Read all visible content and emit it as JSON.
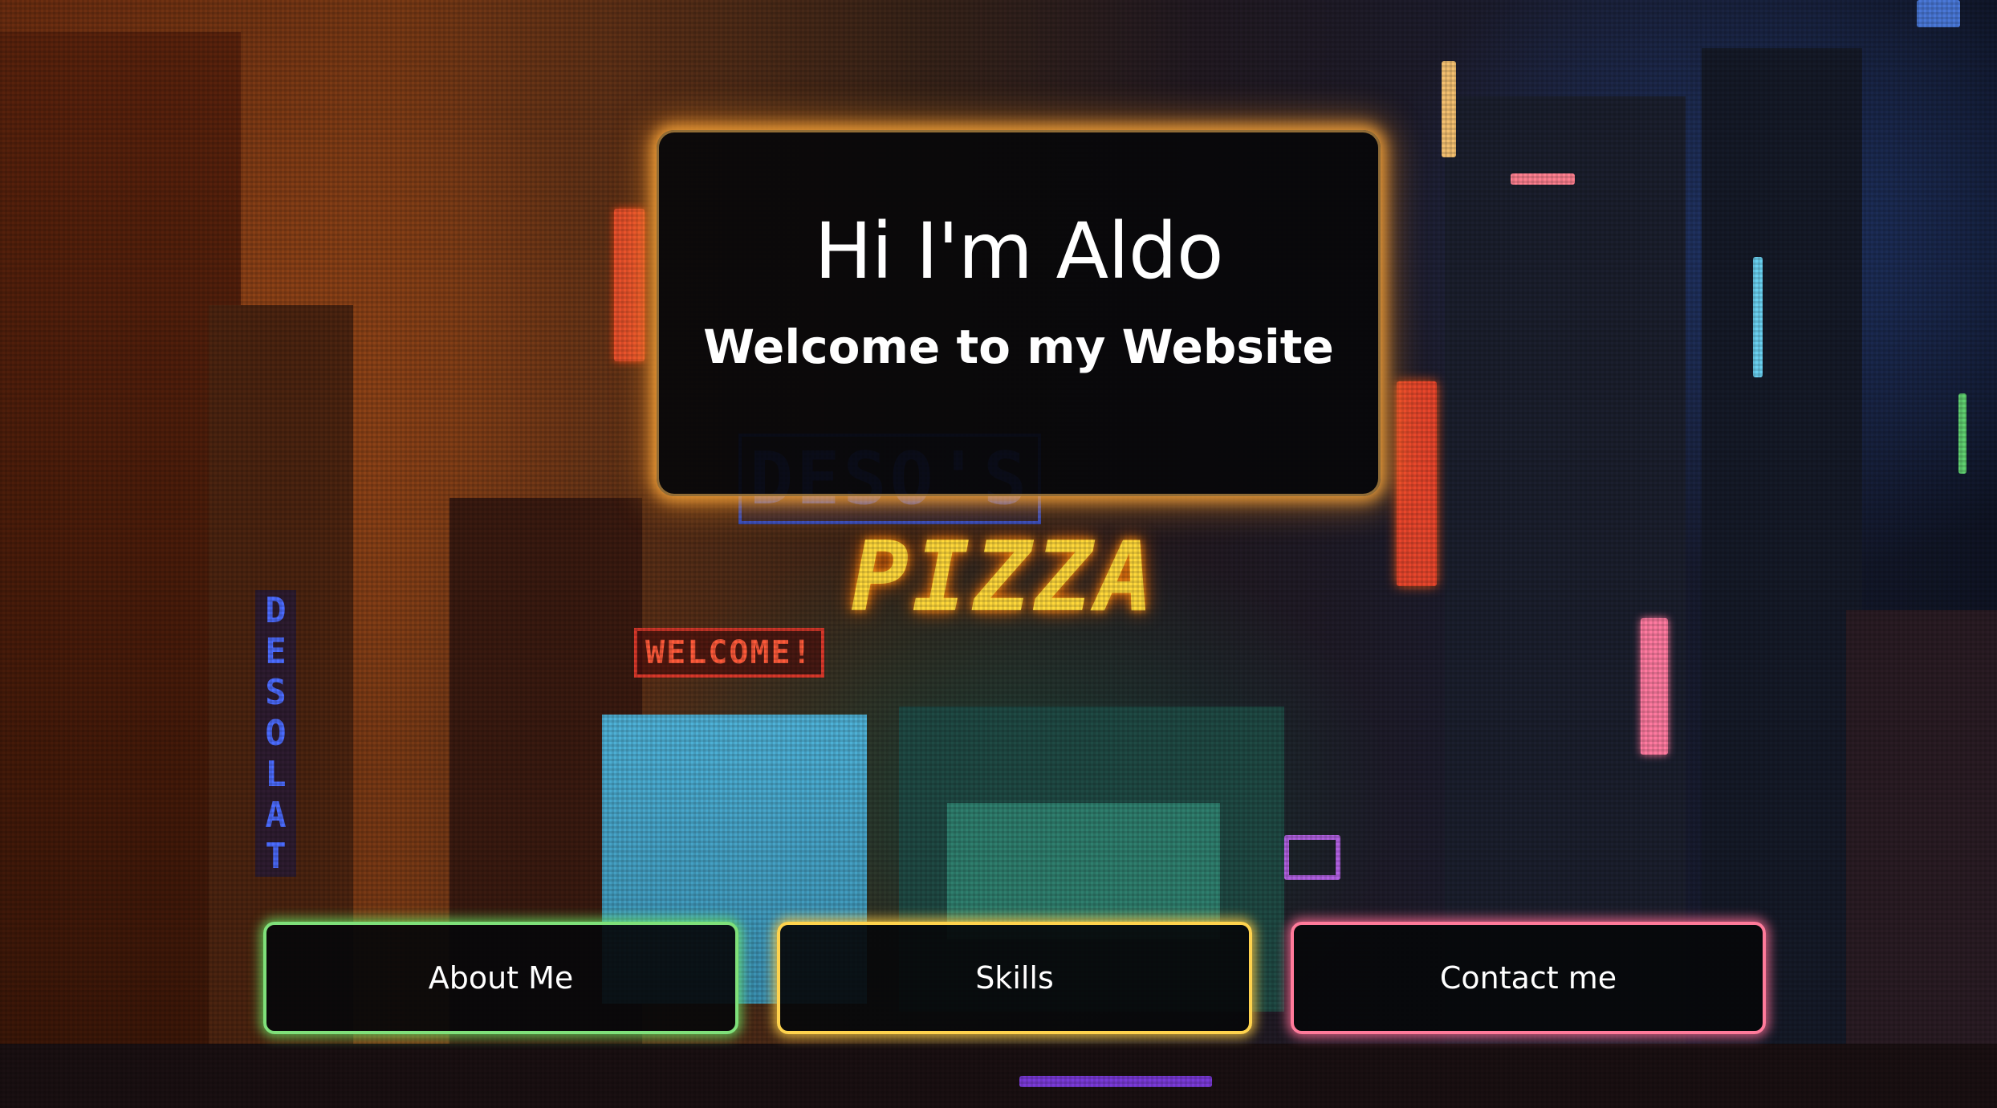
{
  "hero": {
    "title": "Hi I'm Aldo",
    "subtitle": "Welcome to my Website"
  },
  "nav": {
    "about_label": "About Me",
    "skills_label": "Skills",
    "contact_label": "Contact me"
  },
  "background": {
    "signs": {
      "pizza": "PIZZA",
      "welcome": "WELCOME!",
      "desos": "DESO'S",
      "desolate": "DESOLAT"
    }
  },
  "colors": {
    "hero_glow": "#ffb347",
    "about_border": "#7fe07a",
    "skills_border": "#ffd34d",
    "contact_border": "#ff7a9a"
  }
}
